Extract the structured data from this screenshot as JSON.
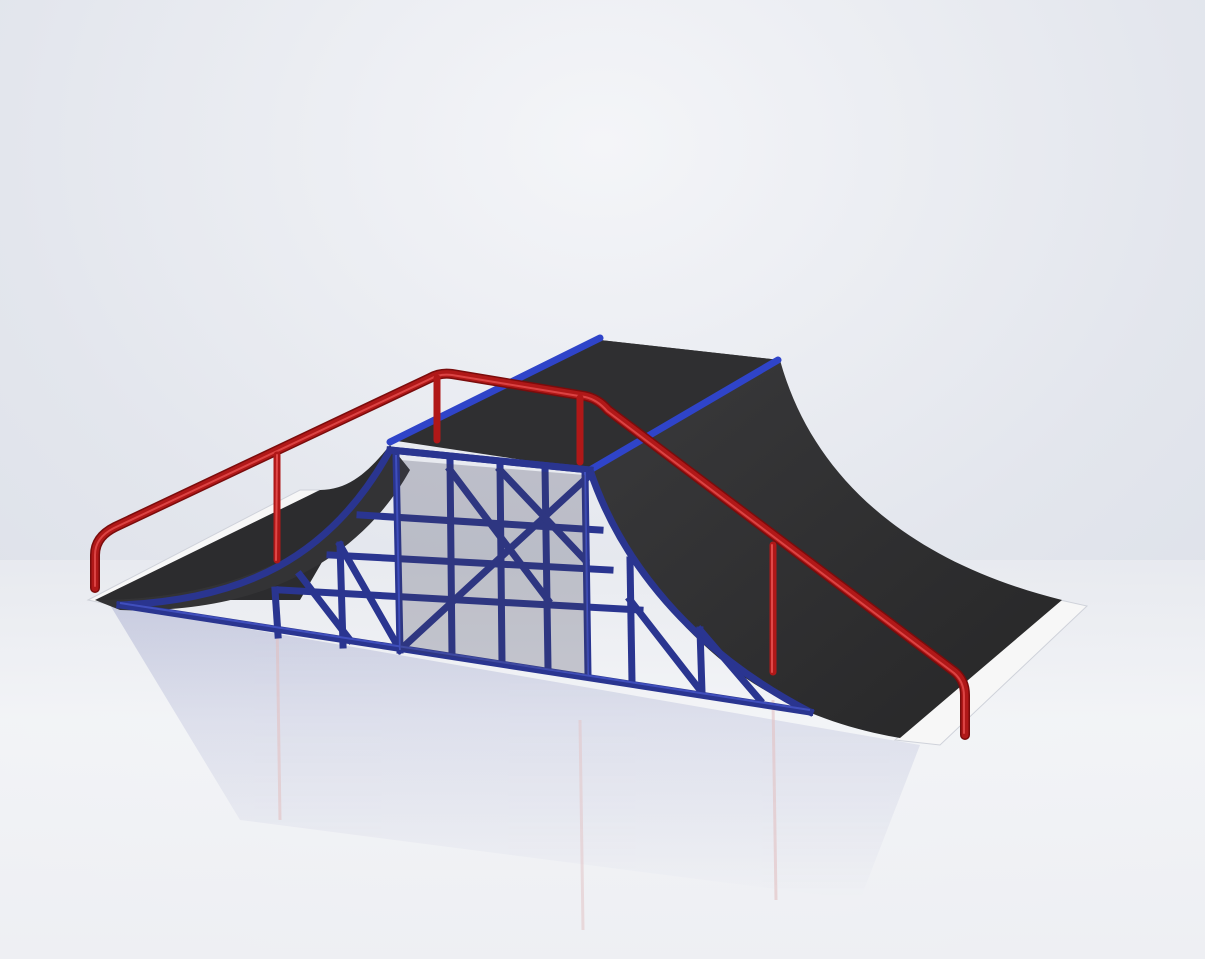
{
  "scene": {
    "subject": "skate-ramp-render",
    "colors": {
      "background_top": "#eceef3",
      "background_mid": "#dde1ea",
      "floor": "#f4f5f8",
      "deck": "#2b2b2c",
      "deck_light": "#3a3a3c",
      "frame": "#2a3590",
      "frame_light": "#4656c8",
      "coping": "#2f44c9",
      "handrail": "#b01818",
      "handrail_light": "#e04848",
      "base_plate": "#f7f7f7"
    },
    "icons": {
      "handrail": "handrail-icon",
      "frame": "truss-frame-icon",
      "deck": "ramp-deck-icon"
    }
  }
}
